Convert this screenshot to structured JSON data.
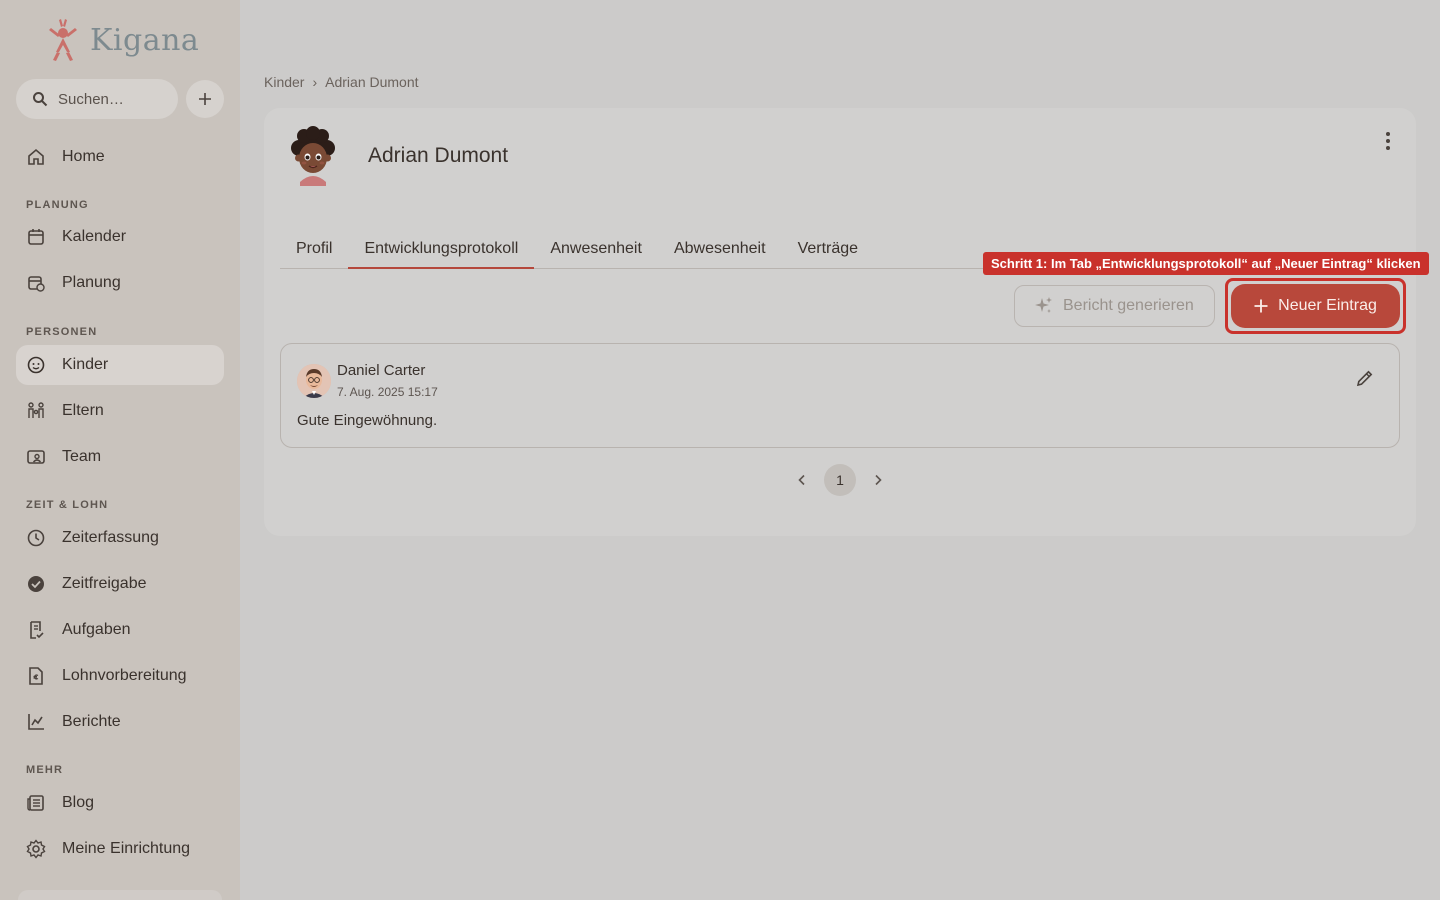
{
  "app": {
    "name": "Kigana"
  },
  "search": {
    "placeholder": "Suchen…"
  },
  "nav": {
    "home": "Home",
    "sections": {
      "planung": "PLANUNG",
      "personen": "PERSONEN",
      "zeit": "ZEIT & LOHN",
      "mehr": "MEHR"
    },
    "kalender": "Kalender",
    "planung": "Planung",
    "kinder": "Kinder",
    "eltern": "Eltern",
    "team": "Team",
    "zeiterfassung": "Zeiterfassung",
    "zeitfreigabe": "Zeitfreigabe",
    "aufgaben": "Aufgaben",
    "lohnvorbereitung": "Lohnvorbereitung",
    "berichte": "Berichte",
    "blog": "Blog",
    "einrichtung": "Meine Einrichtung"
  },
  "breadcrumb": {
    "parent": "Kinder",
    "separator": "›",
    "current": "Adrian Dumont"
  },
  "child": {
    "name": "Adrian Dumont"
  },
  "tabs": [
    "Profil",
    "Entwicklungsprotokoll",
    "Anwesenheit",
    "Abwesenheit",
    "Verträge"
  ],
  "active_tab": "Entwicklungsprotokoll",
  "tooltip": "Schritt 1: Im Tab „Entwicklungsprotokoll“ auf „Neuer Eintrag“ klicken",
  "actions": {
    "report": "Bericht generieren",
    "new_entry": "Neuer Eintrag"
  },
  "entries": [
    {
      "author": "Daniel Carter",
      "date": "7. Aug. 2025 15:17",
      "text": "Gute Eingewöhnung."
    }
  ],
  "pagination": {
    "current": "1"
  },
  "colors": {
    "accent": "#b8483b",
    "highlight": "#c9322c",
    "sidebar": "#c9c3bd",
    "background": "#cccbca"
  }
}
